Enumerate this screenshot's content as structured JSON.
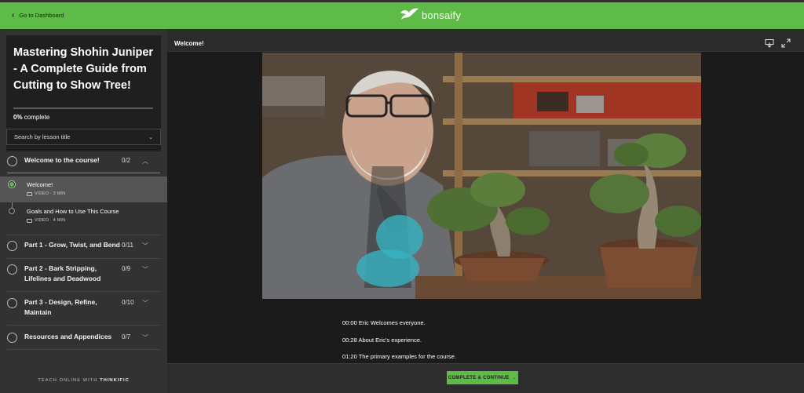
{
  "header": {
    "back_label": "Go to Dashboard",
    "logo_text": "bonsaify",
    "accent": "#5fbb47"
  },
  "course": {
    "title": "Mastering Shohin Juniper - A Complete Guide from Cutting to Show Tree!",
    "progress_percent": 0,
    "progress_value": "0%",
    "progress_suffix": " complete"
  },
  "search": {
    "placeholder": "Search by lesson title"
  },
  "chapters": [
    {
      "title": "Welcome to the course!",
      "count": "0/2",
      "expanded": true
    },
    {
      "title": "Part 1 - Grow, Twist, and Bend",
      "count": "0/11"
    },
    {
      "title": "Part 2 - Bark Stripping, Lifelines and Deadwood",
      "count": "0/9"
    },
    {
      "title": "Part 3 - Design, Refine, Maintain",
      "count": "0/10"
    },
    {
      "title": "Resources and Appendices",
      "count": "0/7"
    }
  ],
  "lessons": [
    {
      "title": "Welcome!",
      "meta": "VIDEO · 3 MIN",
      "active": true
    },
    {
      "title": "Goals and How to Use This Course",
      "meta": "VIDEO · 4 MIN"
    }
  ],
  "sidebar_footer": {
    "prefix": "TEACH ONLINE WITH ",
    "brand": "THINKIFIC"
  },
  "main": {
    "lesson_title": "Welcome!",
    "notes": [
      "00:00 Eric Welcomes everyone.",
      "00:28 About Eric's experience.",
      "01:20 The primary examples for the course."
    ],
    "cta_label": "COMPLETE & CONTINUE",
    "cta_arrow": "→"
  },
  "icons": {
    "back": "chevron-left-icon",
    "logo": "bird-icon",
    "chapter_status": "circle-icon",
    "download": "download-icon",
    "fullscreen": "expand-icon",
    "video_type": "video-camera-icon"
  }
}
